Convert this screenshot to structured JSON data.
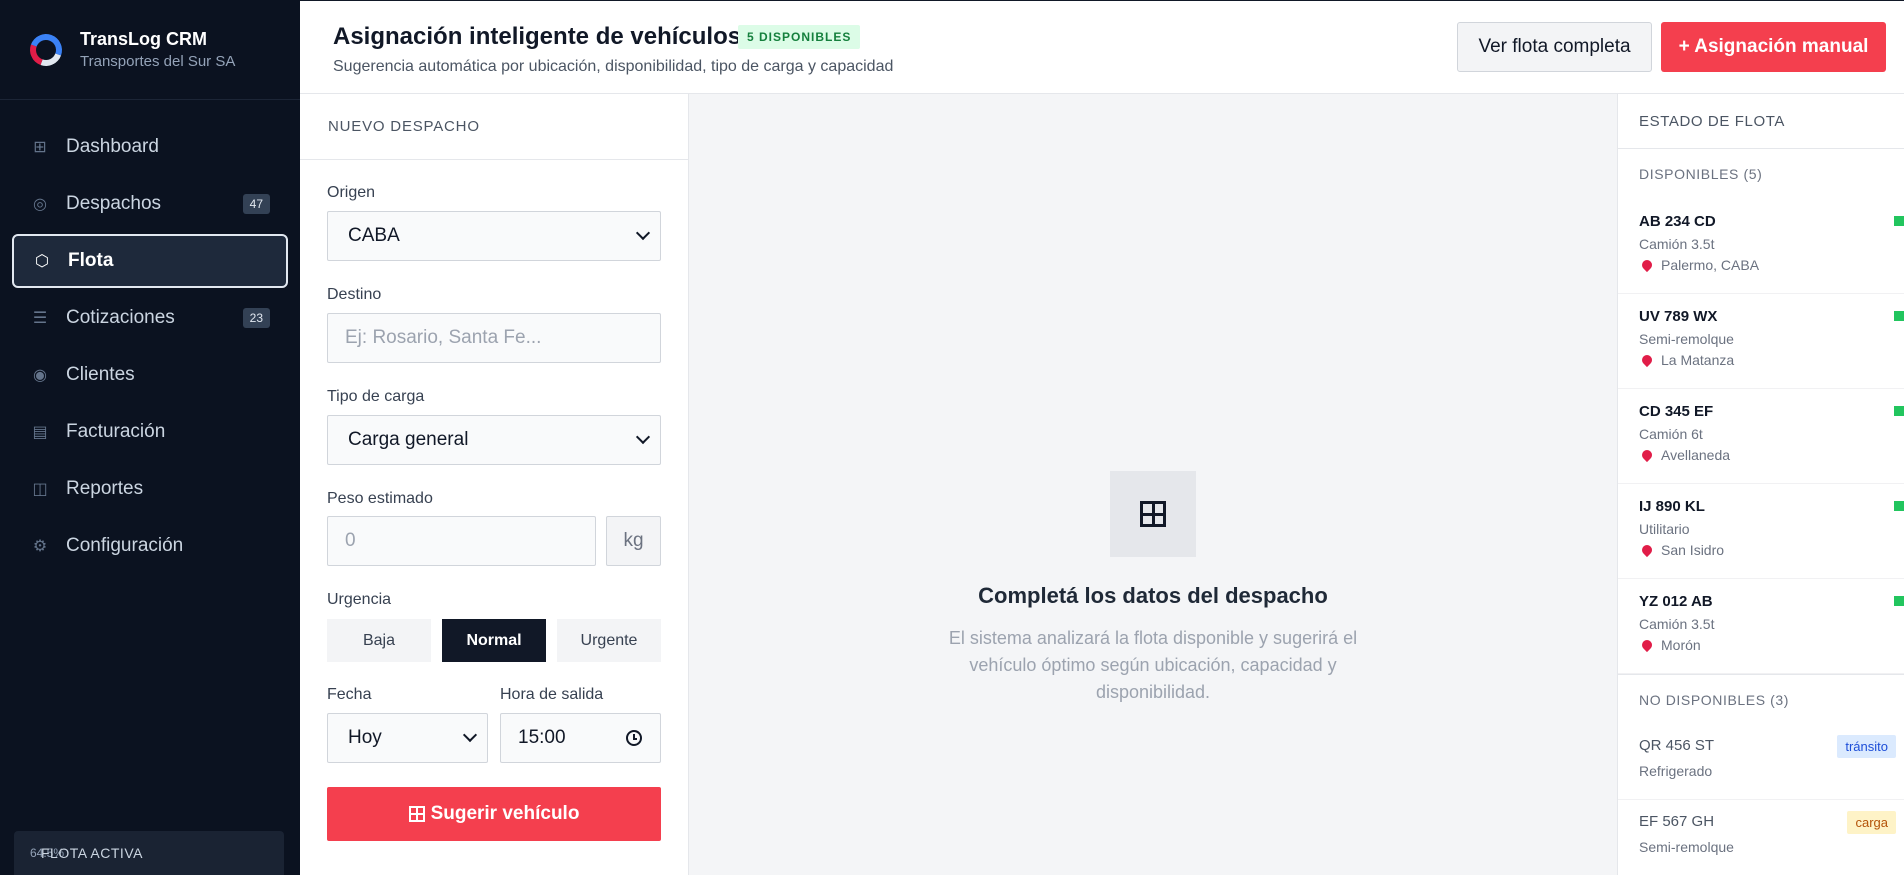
{
  "brand": {
    "name": "TransLog CRM",
    "subtitle": "Transportes del Sur SA"
  },
  "sidebar": {
    "items": [
      {
        "label": "Dashboard",
        "icon": "grid-icon",
        "badge": ""
      },
      {
        "label": "Despachos",
        "icon": "target-icon",
        "badge": "47"
      },
      {
        "label": "Flota",
        "icon": "hexagon-icon",
        "badge": "",
        "active": true
      },
      {
        "label": "Cotizaciones",
        "icon": "list-icon",
        "badge": "23"
      },
      {
        "label": "Clientes",
        "icon": "user-circle-icon",
        "badge": ""
      },
      {
        "label": "Facturación",
        "icon": "invoice-icon",
        "badge": ""
      },
      {
        "label": "Reportes",
        "icon": "book-icon",
        "badge": ""
      },
      {
        "label": "Configuración",
        "icon": "gear-icon",
        "badge": ""
      }
    ],
    "fleet_active": {
      "label": "FLOTA ACTIVA",
      "percent": "64.5%"
    }
  },
  "header": {
    "title": "Asignación inteligente de vehículos",
    "badge": "5 DISPONIBLES",
    "subtitle": "Sugerencia automática por ubicación, disponibilidad, tipo de carga y capacidad",
    "btn_fleet": "Ver flota completa",
    "btn_manual": "+ Asignación manual"
  },
  "form": {
    "heading": "NUEVO DESPACHO",
    "origin_label": "Origen",
    "origin_value": "CABA",
    "dest_label": "Destino",
    "dest_placeholder": "Ej: Rosario, Santa Fe...",
    "cargo_label": "Tipo de carga",
    "cargo_value": "Carga general",
    "weight_label": "Peso estimado",
    "weight_placeholder": "0",
    "weight_unit": "kg",
    "urgency_label": "Urgencia",
    "urgency_options": [
      "Baja",
      "Normal",
      "Urgente"
    ],
    "urgency_selected": "Normal",
    "date_label": "Fecha",
    "date_value": "Hoy",
    "time_label": "Hora de salida",
    "time_value": "15:00",
    "submit": "Sugerir vehículo"
  },
  "empty": {
    "title": "Completá los datos del despacho",
    "description": "El sistema analizará la flota disponible y sugerirá el vehículo óptimo según ubicación, capacidad y disponibilidad."
  },
  "fleet": {
    "heading": "ESTADO DE FLOTA",
    "available_title": "DISPONIBLES (5)",
    "available": [
      {
        "plate": "AB 234 CD",
        "type": "Camión 3.5t",
        "location": "Palermo, CABA"
      },
      {
        "plate": "UV 789 WX",
        "type": "Semi-remolque",
        "location": "La Matanza"
      },
      {
        "plate": "CD 345 EF",
        "type": "Camión 6t",
        "location": "Avellaneda"
      },
      {
        "plate": "IJ 890 KL",
        "type": "Utilitario",
        "location": "San Isidro"
      },
      {
        "plate": "YZ 012 AB",
        "type": "Camión 3.5t",
        "location": "Morón"
      }
    ],
    "unavailable_title": "NO DISPONIBLES (3)",
    "unavailable": [
      {
        "plate": "QR 456 ST",
        "type": "Refrigerado",
        "status": "tránsito"
      },
      {
        "plate": "EF 567 GH",
        "type": "Semi-remolque",
        "status": "carga"
      }
    ],
    "colors": {
      "available": "#22c55e",
      "accent": "#f43f4e"
    }
  }
}
